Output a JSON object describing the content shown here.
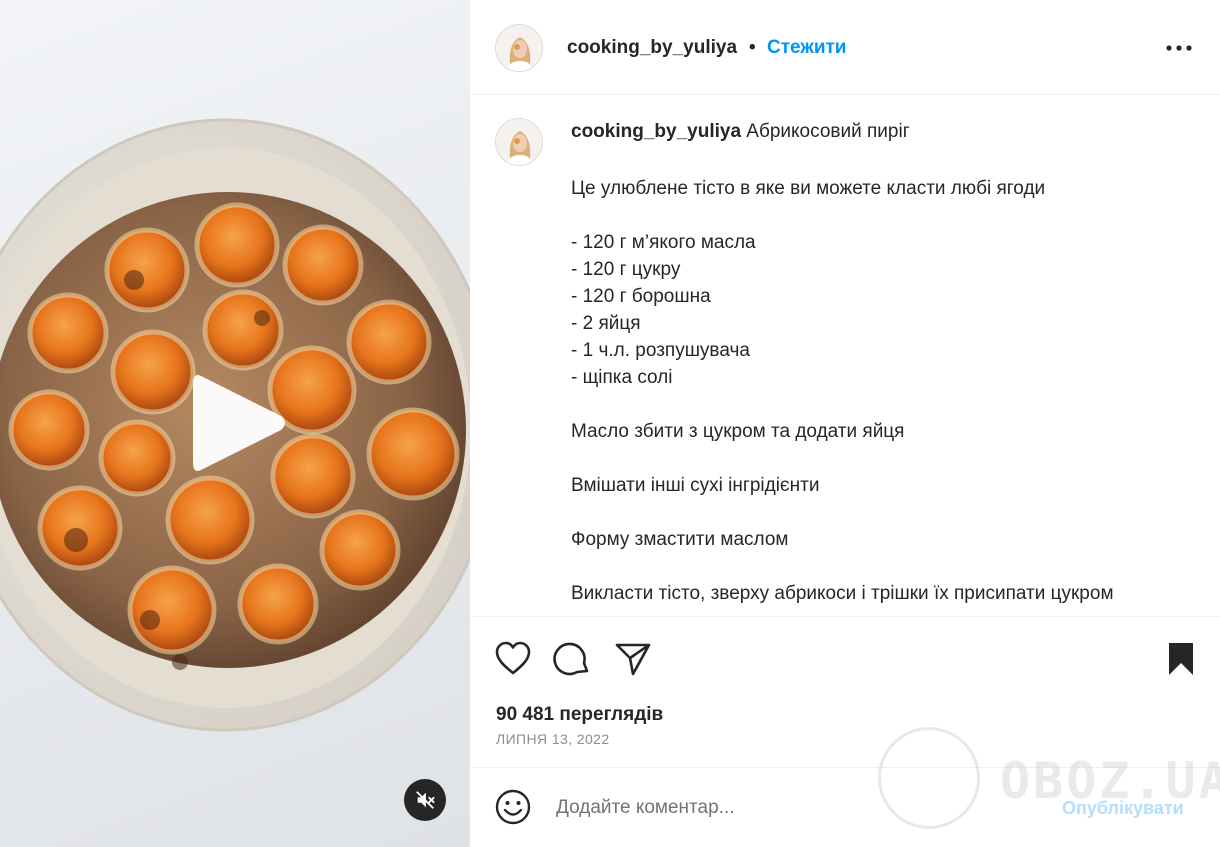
{
  "post": {
    "username": "cooking_by_yuliya",
    "separator": "•",
    "follow_label": "Стежити",
    "more_icon": "more-horizontal-icon"
  },
  "caption": {
    "username": "cooking_by_yuliya",
    "title": "Абрикосовий пиріг",
    "lines": [
      "Це улюблене тісто в яке ви можете класти любі ягоди",
      "",
      "- 120 г м’якого масла",
      "- 120 г цукру",
      "- 120 г борошна",
      "- 2 яйця",
      "- 1 ч.л. розпушувача",
      "- щіпка солі",
      "",
      "Масло збити з цукром та додати яйця",
      "",
      "Вмішати інші сухі інгрідієнти",
      "",
      "Форму змастити маслом",
      "",
      "Викласти тісто, зверху абрикоси і трішки їх присипати цукром"
    ]
  },
  "stats": {
    "views": "90 481 переглядів",
    "date": "ЛИПНЯ 13, 2022"
  },
  "comment": {
    "placeholder": "Додайте коментар...",
    "publish_label": "Опублікувати"
  },
  "watermark": {
    "text": "OBOZ.UA"
  },
  "colors": {
    "accent": "#0095f6",
    "publish_disabled": "#b2dffc",
    "text": "#262626",
    "muted": "#8e8e8e"
  }
}
